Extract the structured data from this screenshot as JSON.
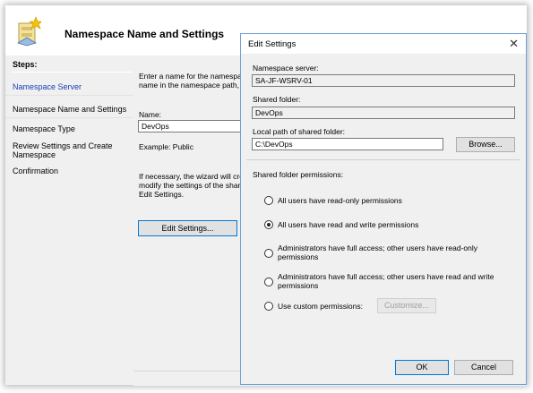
{
  "wizard": {
    "title": "Namespace Name and Settings",
    "steps_label": "Steps:",
    "steps": [
      {
        "label": "Namespace Server",
        "active": true
      },
      {
        "label": "Namespace Name and Settings",
        "active": false
      },
      {
        "label": "Namespace Type",
        "active": false
      },
      {
        "label": "Review Settings and Create Namespace",
        "active": false
      },
      {
        "label": "Confirmation",
        "active": false
      }
    ],
    "intro_line1": "Enter a name for the namespace",
    "intro_line2": "name in the namespace path, su",
    "name_label": "Name:",
    "name_value": "DevOps",
    "example_text": "Example: Public",
    "note_line1": "If necessary, the wizard will crea",
    "note_line2": "modify the settings of the shared",
    "note_line3": "Edit Settings.",
    "edit_settings_button": "Edit Settings..."
  },
  "dialog": {
    "title": "Edit Settings",
    "close_glyph": "✕",
    "namespace_server_label": "Namespace server:",
    "namespace_server_value": "SA-JF-WSRV-01",
    "shared_folder_label": "Shared folder:",
    "shared_folder_value": "DevOps",
    "local_path_label": "Local path of shared folder:",
    "local_path_value": "C:\\DevOps",
    "browse_button": "Browse...",
    "permissions_label": "Shared folder permissions:",
    "permissions": [
      {
        "label_line1": "All users have read-only permissions",
        "label_line2": "",
        "checked": false
      },
      {
        "label_line1": "All users have read and write permissions",
        "label_line2": "",
        "checked": true
      },
      {
        "label_line1": "Administrators have full access; other users have read-only",
        "label_line2": "permissions",
        "checked": false
      },
      {
        "label_line1": "Administrators have full access; other users have read and write",
        "label_line2": "permissions",
        "checked": false
      },
      {
        "label_line1": "Use custom permissions:",
        "label_line2": "",
        "checked": false
      }
    ],
    "customize_button": "Customize...",
    "ok_button": "OK",
    "cancel_button": "Cancel"
  }
}
